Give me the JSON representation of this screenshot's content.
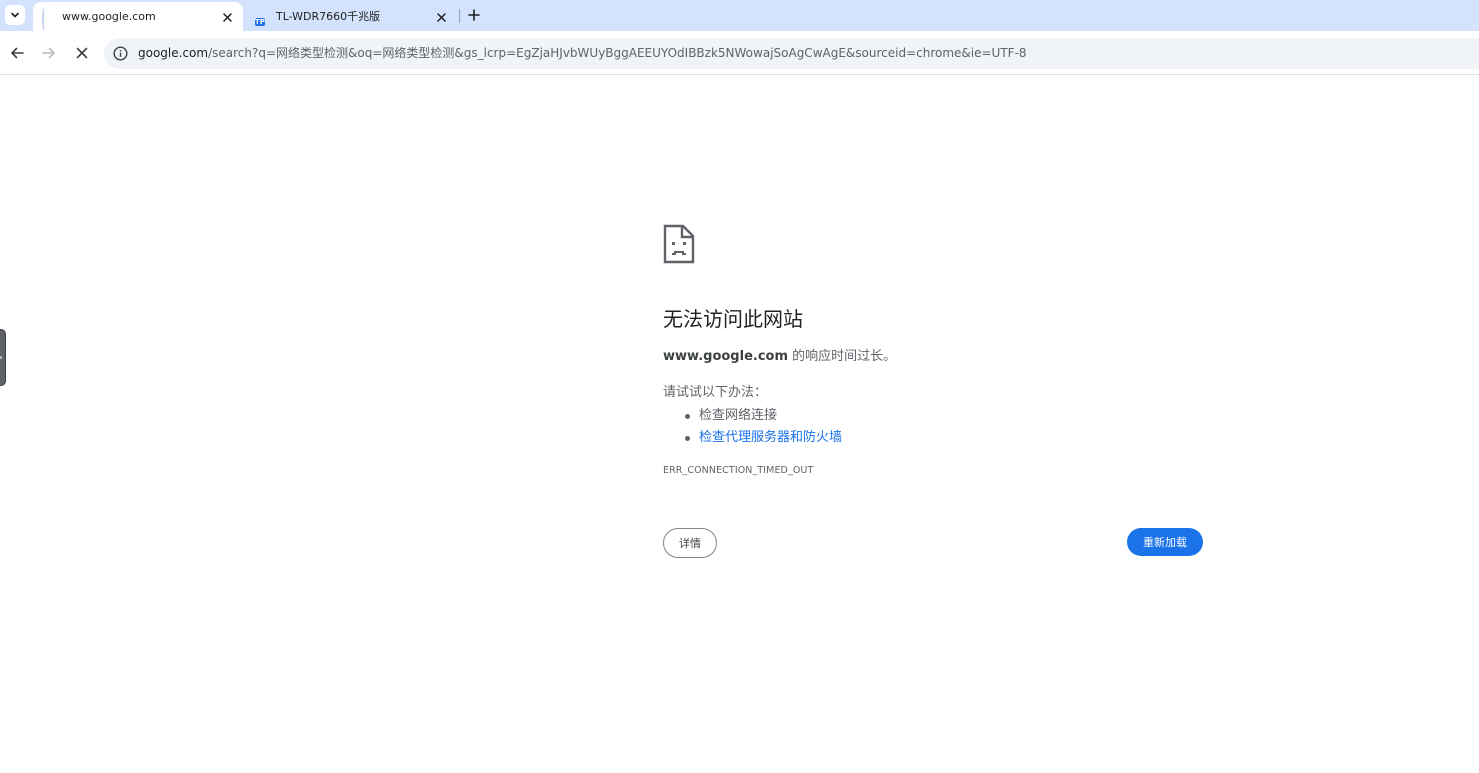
{
  "tabs": [
    {
      "title": "www.google.com",
      "favicon": "loading-spinner-icon",
      "active": true
    },
    {
      "title": "TL-WDR7660千兆版",
      "favicon": "tp-link-icon",
      "favicon_text": "TP",
      "active": false
    }
  ],
  "toolbar": {
    "url_host": "google.com",
    "url_rest": "/search?q=网络类型检测&oq=网络类型检测&gs_lcrp=EgZjaHJvbWUyBggAEEUYOdIBBzk5NWowajSoAgCwAgE&sourceid=chrome&ie=UTF-8"
  },
  "error_page": {
    "title": "无法访问此网站",
    "summary_host": "www.google.com",
    "summary_text": " 的响应时间过长。",
    "try_label": "请试试以下办法：",
    "suggestions": [
      "检查网络连接",
      "检查代理服务器和防火墙"
    ],
    "error_code": "ERR_CONNECTION_TIMED_OUT",
    "details_button": "详情",
    "reload_button": "重新加载"
  },
  "colors": {
    "tabstrip_bg": "#d3e3fd",
    "accent": "#1a73e8",
    "text_primary": "#202124",
    "text_secondary": "#5f6368"
  }
}
